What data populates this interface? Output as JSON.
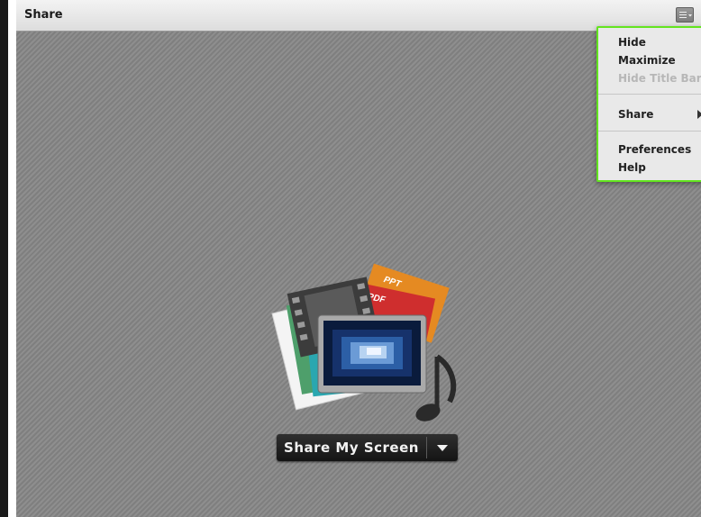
{
  "window": {
    "title": "Share"
  },
  "menu_button": {
    "icon": "menu-lines-icon"
  },
  "options_menu": {
    "items": [
      {
        "label": "Hide",
        "enabled": true
      },
      {
        "label": "Maximize",
        "enabled": true
      },
      {
        "label": "Hide Title Bar",
        "enabled": false
      },
      {
        "label": "Share",
        "enabled": true,
        "submenu": true
      },
      {
        "label": "Preferences",
        "enabled": true
      },
      {
        "label": "Help",
        "enabled": true
      }
    ],
    "highlight_color": "#63e41f"
  },
  "illustration": {
    "doc_labels": {
      "ppt": "PPT",
      "pdf": "PDF"
    }
  },
  "share_button": {
    "label": "Share My Screen"
  }
}
